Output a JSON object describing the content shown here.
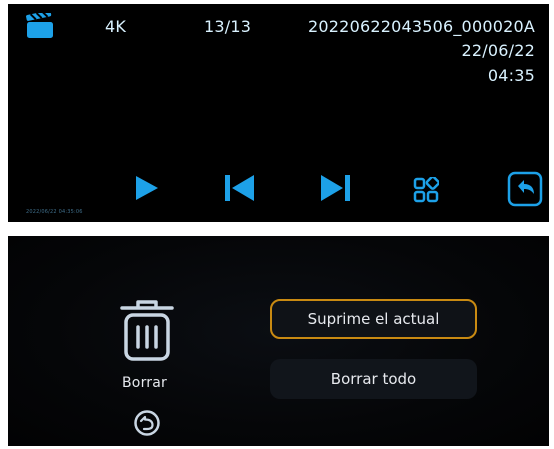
{
  "playback": {
    "mode_icon": "video-clapperboard-icon",
    "resolution": "4K",
    "counter": "13/13",
    "filename": "20220622043506_000020A",
    "date": "22/06/22",
    "time": "04:35",
    "osd_stamp": "2022/06/22 04:35:06",
    "controls": {
      "play_icon": "play-icon",
      "prev_icon": "skip-previous-icon",
      "next_icon": "skip-next-icon",
      "thumbnails_icon": "thumbnail-grid-icon",
      "back_icon": "return-back-icon"
    },
    "accent_color": "#1da1e8"
  },
  "delete_menu": {
    "icon": "trash-icon",
    "label": "Borrar",
    "back_icon": "return-back-icon",
    "options": [
      {
        "label": "Suprime el actual",
        "selected": true
      },
      {
        "label": "Borrar todo",
        "selected": false
      }
    ],
    "highlight_color": "#c98a12"
  }
}
